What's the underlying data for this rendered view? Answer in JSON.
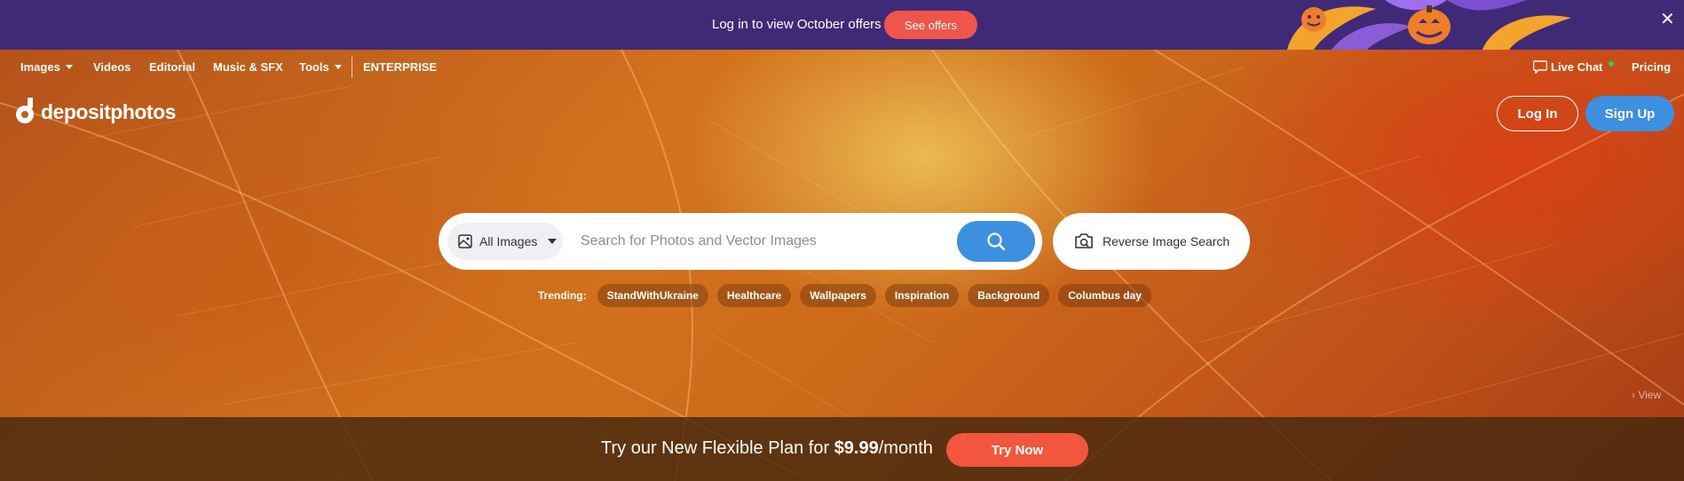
{
  "promo": {
    "text": "Log in to view October offers",
    "button": "See offers",
    "close": "✕"
  },
  "nav": {
    "images": "Images",
    "videos": "Videos",
    "editorial": "Editorial",
    "music": "Music & SFX",
    "tools": "Tools",
    "enterprise": "ENTERPRISE",
    "live_chat": "Live Chat",
    "pricing": "Pricing"
  },
  "header": {
    "logo": "depositphotos",
    "login": "Log In",
    "signup": "Sign Up"
  },
  "search": {
    "category": "All Images",
    "placeholder": "Search for Photos and Vector Images",
    "reverse": "Reverse Image Search"
  },
  "trending": {
    "label": "Trending:",
    "tags": [
      "StandWithUkraine",
      "Healthcare",
      "Wallpapers",
      "Inspiration",
      "Background",
      "Columbus day"
    ]
  },
  "view_link": "View",
  "bottom": {
    "text_prefix": "Try our New Flexible Plan for ",
    "price": "$9.99",
    "text_suffix": "/month",
    "button": "Try Now"
  },
  "colors": {
    "promo_bg": "#3f2a78",
    "accent_blue": "#3d8fe0",
    "promo_button": "#f0554a",
    "try_button": "#f2573d"
  }
}
